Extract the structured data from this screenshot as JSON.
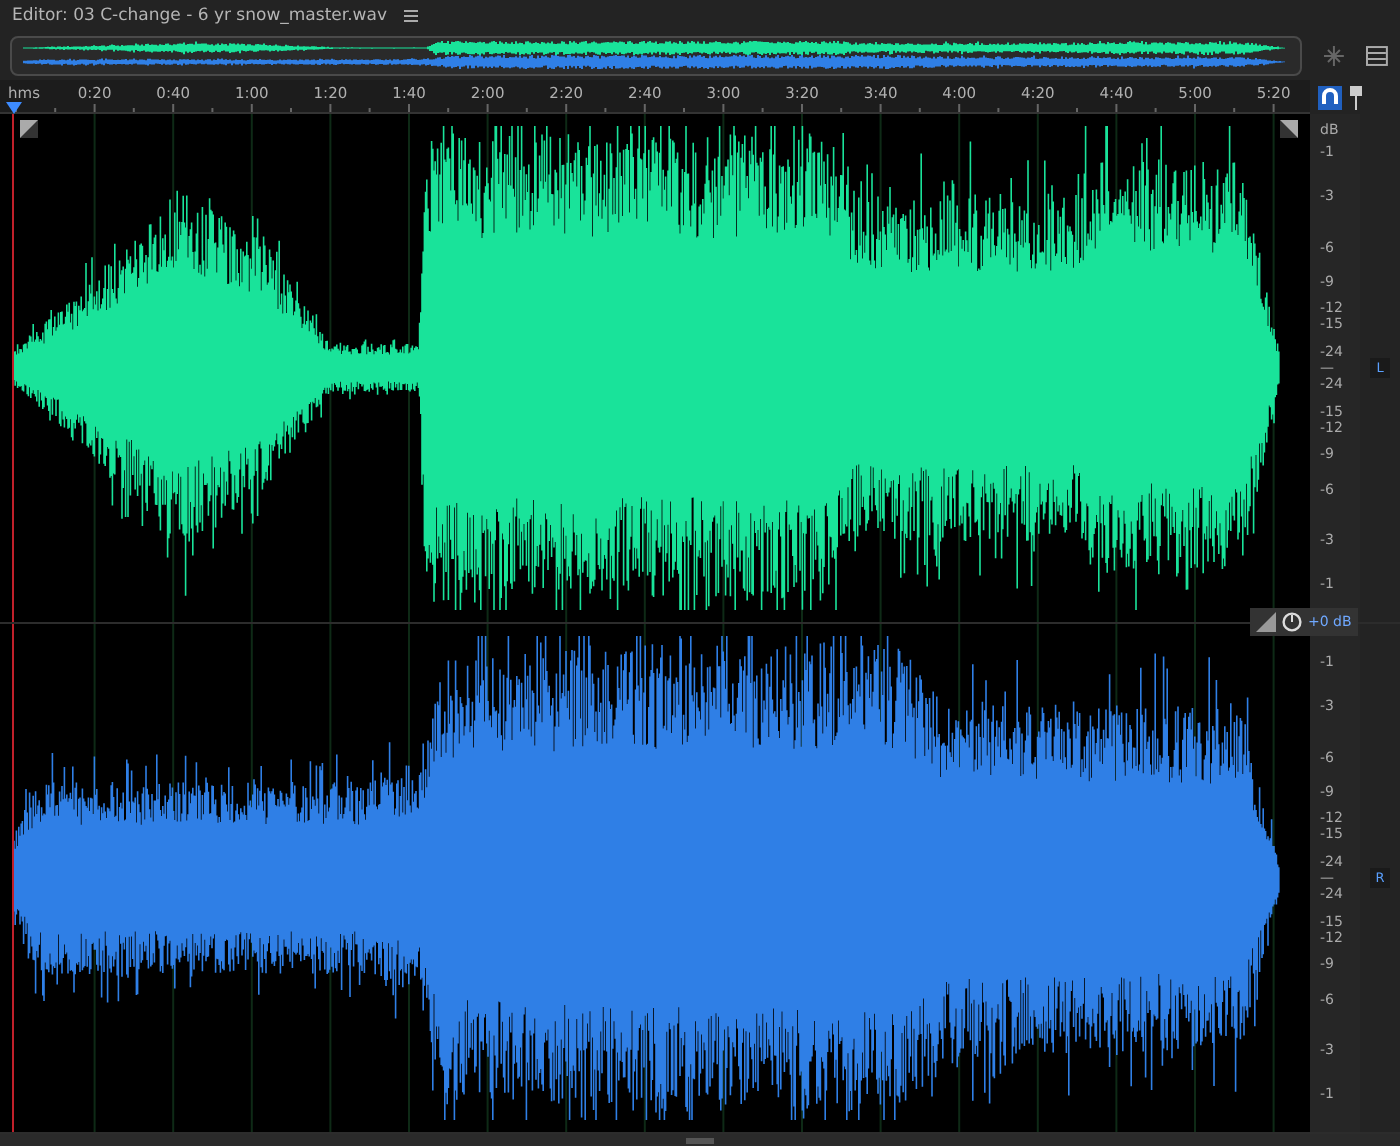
{
  "editor": {
    "title": "Editor: 03 C-change - 6 yr snow_master.wav"
  },
  "ruler": {
    "labels": [
      "hms",
      "0:20",
      "0:40",
      "1:00",
      "1:20",
      "1:40",
      "2:00",
      "2:20",
      "2:40",
      "3:00",
      "3:20",
      "3:40",
      "4:00",
      "4:20",
      "4:40",
      "5:00",
      "5:20"
    ]
  },
  "channels": [
    {
      "tag": "L",
      "unit": "dB",
      "scale": [
        "-1",
        "-3",
        "-6",
        "-9",
        "-12",
        "-15",
        "-24",
        "—",
        "-24",
        "-15",
        "-12",
        "-9",
        "-6",
        "-3",
        "-1"
      ]
    },
    {
      "tag": "R",
      "scale": [
        "-1",
        "-3",
        "-6",
        "-9",
        "-12",
        "-15",
        "-24",
        "—",
        "-24",
        "-15",
        "-12",
        "-9",
        "-6",
        "-3",
        "-1"
      ]
    }
  ],
  "gain_hud": {
    "reading": "+0 dB"
  }
}
